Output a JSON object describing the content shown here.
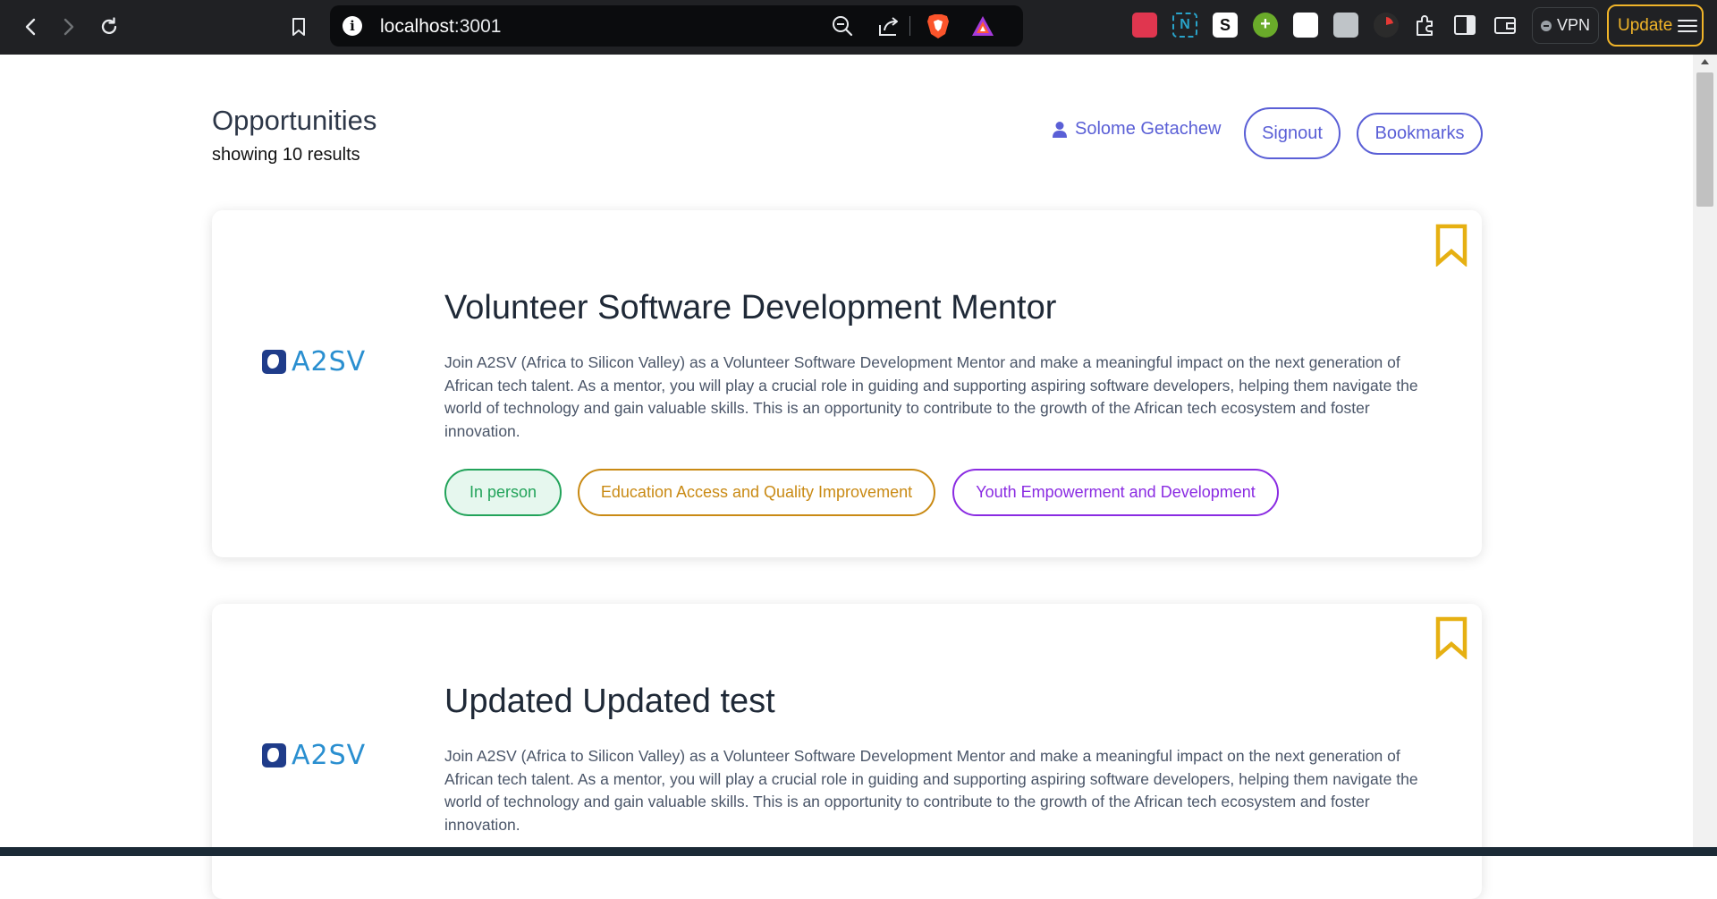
{
  "browser": {
    "url_host": "localhost",
    "url_port": ":3001",
    "vpn_label": "VPN",
    "update_label": "Update"
  },
  "header": {
    "title": "Opportunities",
    "results": "showing 10 results",
    "user_name": "Solome Getachew",
    "signout_label": "Signout",
    "bookmarks_label": "Bookmarks"
  },
  "opportunities": [
    {
      "logo_text": "A2SV",
      "title": "Volunteer Software Development Mentor",
      "description": "Join A2SV (Africa to Silicon Valley) as a Volunteer Software Development Mentor and make a meaningful impact on the next generation of African tech talent. As a mentor, you will play a crucial role in guiding and supporting aspiring software developers, helping them navigate the world of technology and gain valuable skills. This is an opportunity to contribute to the growth of the African tech ecosystem and foster innovation.",
      "tags": [
        {
          "label": "In person",
          "color": "#22a35a",
          "bg": "#e6f7ee"
        },
        {
          "label": "Education Access and Quality Improvement",
          "color": "#c98a14",
          "bg": "#ffffff"
        },
        {
          "label": "Youth Empowerment and Development",
          "color": "#8a2be2",
          "bg": "#ffffff"
        }
      ]
    },
    {
      "logo_text": "A2SV",
      "title": "Updated Updated test",
      "description": "Join A2SV (Africa to Silicon Valley) as a Volunteer Software Development Mentor and make a meaningful impact on the next generation of African tech talent. As a mentor, you will play a crucial role in guiding and supporting aspiring software developers, helping them navigate the world of technology and gain valuable skills. This is an opportunity to contribute to the growth of the African tech ecosystem and foster innovation."
    }
  ],
  "colors": {
    "accent": "#5a5fd6",
    "bookmark": "#e6b012"
  },
  "icons": [
    "back-icon",
    "forward-icon",
    "reload-icon",
    "bookmark-page-icon",
    "zoom-out-icon",
    "share-icon",
    "brave-shield-icon",
    "brave-rewards-icon",
    "user-icon",
    "bookmark-icon"
  ]
}
